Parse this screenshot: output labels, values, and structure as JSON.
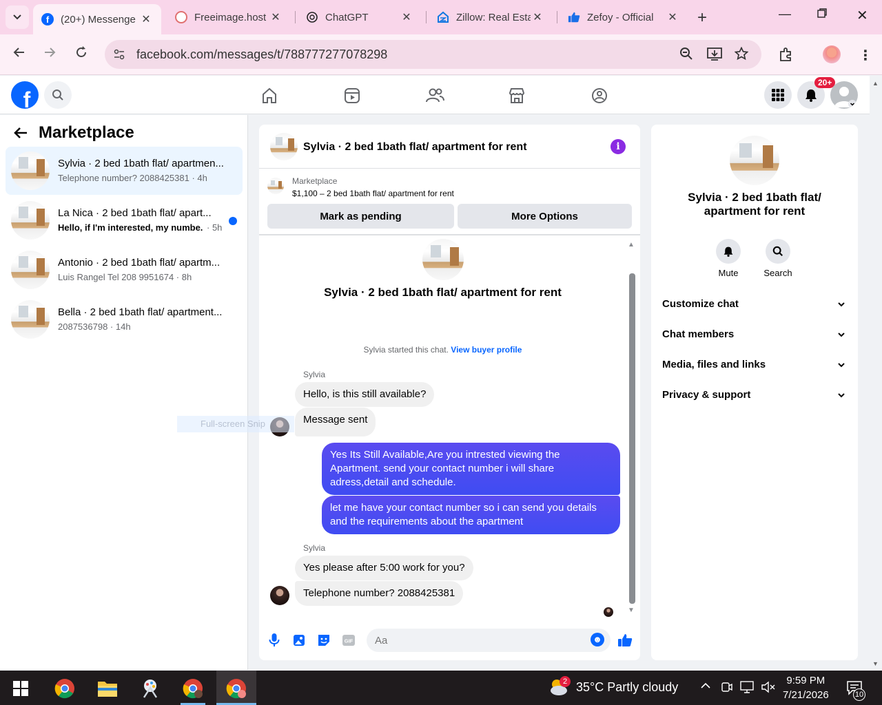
{
  "browser": {
    "tabs": [
      {
        "label": "(20+) Messenge",
        "active": true
      },
      {
        "label": "Freeimage.host"
      },
      {
        "label": "ChatGPT"
      },
      {
        "label": "Zillow: Real Esta"
      },
      {
        "label": "Zefoy - Official"
      }
    ],
    "url": "facebook.com/messages/t/788777277078298"
  },
  "fb": {
    "notif_badge": "20+"
  },
  "sidebar": {
    "title": "Marketplace",
    "conversations": [
      {
        "name": "Sylvia · 2 bed 1bath flat/ apartmen...",
        "preview": "Telephone number? 2088425381 · 4h",
        "active": true
      },
      {
        "name": "La Nica · 2 bed 1bath flat/ apart...",
        "preview": "Hello, if I'm interested, my numbe...",
        "time": "· 5h",
        "unread": true
      },
      {
        "name": "Antonio · 2 bed 1bath flat/ apartm...",
        "preview": "Luis Rangel Tel 208 9951674 · 8h"
      },
      {
        "name": "Bella · 2 bed 1bath flat/ apartment...",
        "preview": "2087536798 · 14h"
      }
    ]
  },
  "chat": {
    "header_title": "Sylvia · 2 bed 1bath flat/ apartment for rent",
    "marketplace_label": "Marketplace",
    "listing": "$1,100 – 2 bed 1bath flat/ apartment for rent",
    "mark_pending": "Mark as pending",
    "more_options": "More Options",
    "intro_title": "Sylvia · 2 bed 1bath flat/ apartment for rent",
    "started_text": "Sylvia started this chat.",
    "view_profile": "View buyer profile",
    "sender_name": "Sylvia",
    "messages": [
      {
        "from": "in",
        "text": "Hello, is this still available?"
      },
      {
        "from": "in",
        "text": "Message sent"
      },
      {
        "from": "out",
        "text": "Yes Its Still Available,Are you intrested viewing the Apartment. send your contact number i will share adress,detail and schedule."
      },
      {
        "from": "out",
        "text": "let me have your contact number so i can send you details and the requirements about the apartment"
      },
      {
        "from": "in",
        "text": "Yes please after 5:00 work for you?"
      },
      {
        "from": "in",
        "text": "Telephone number? 2088425381"
      }
    ],
    "composer_placeholder": "Aa",
    "ghost_text": "Full-screen Snip"
  },
  "details": {
    "title": "Sylvia · 2 bed 1bath flat/ apartment for rent",
    "mute": "Mute",
    "search": "Search",
    "sections": [
      "Customize chat",
      "Chat members",
      "Media, files and links",
      "Privacy & support"
    ]
  },
  "taskbar": {
    "weather_badge": "2",
    "weather": "35°C  Partly cloudy",
    "time": "9:59 PM",
    "date": "7/21/2026",
    "notif_count": "10"
  },
  "colors": {
    "fb_blue": "#0866ff",
    "outgoing_bubble": "#4a4af0",
    "tabbar": "#f9d6ea"
  }
}
